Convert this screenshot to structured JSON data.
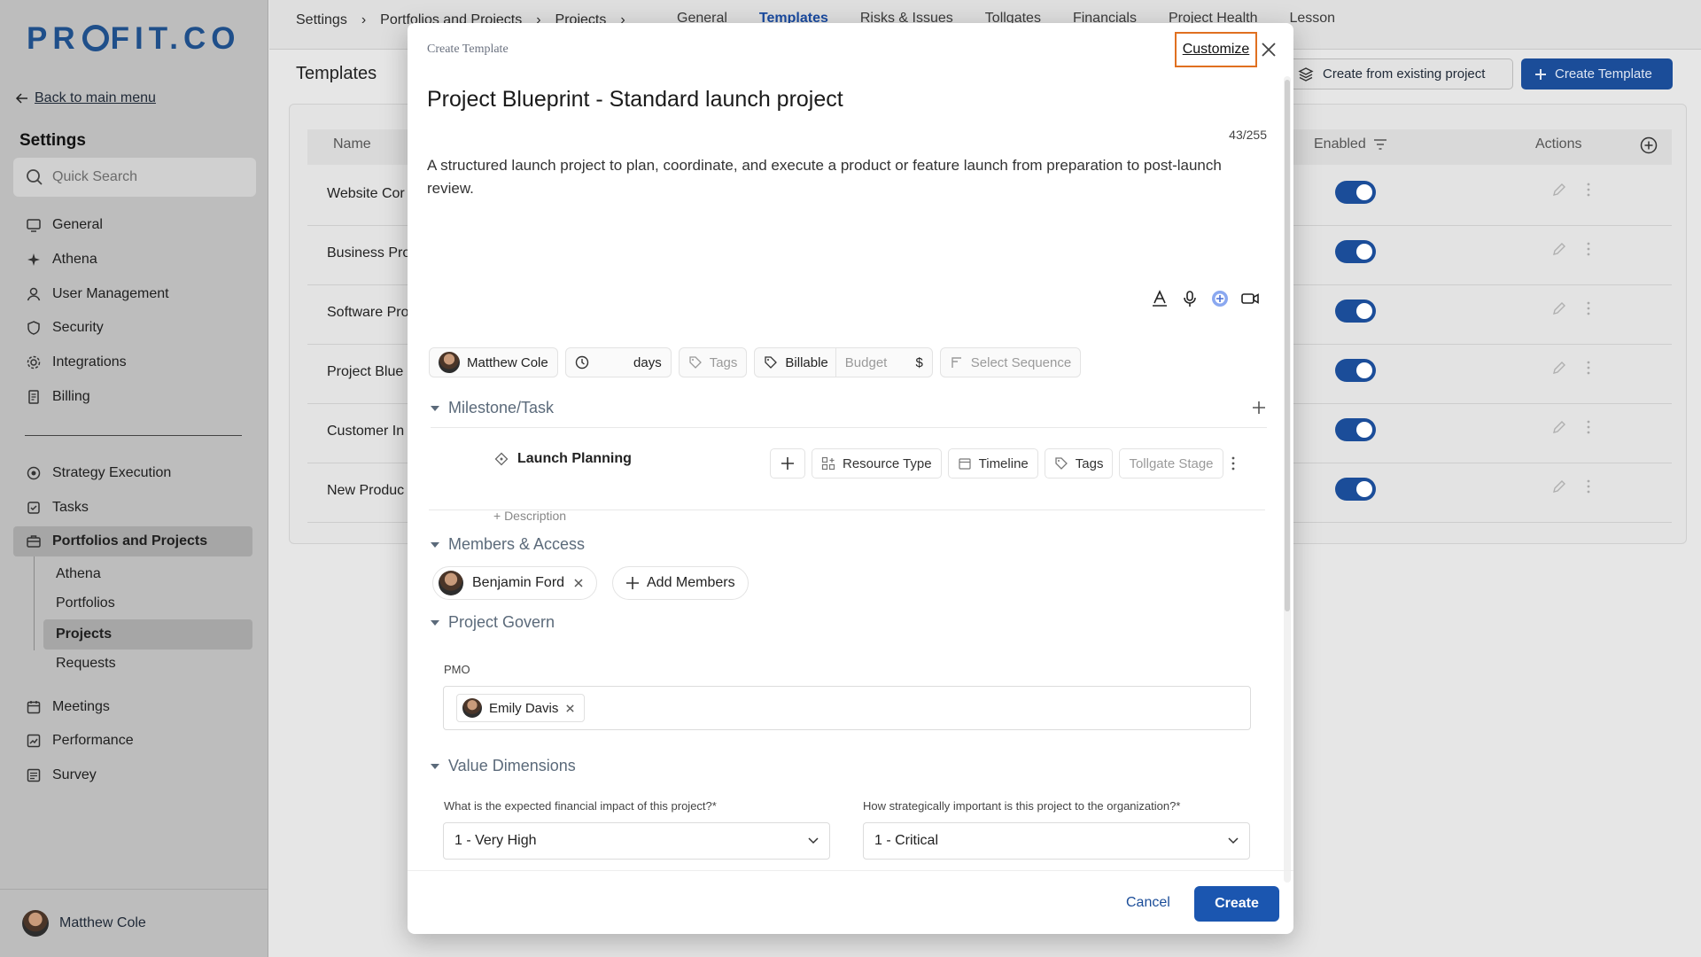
{
  "brand": {
    "logo_text_a": "PR",
    "logo_text_b": "FIT.CO"
  },
  "sidebar": {
    "back_label": "Back to main menu",
    "title": "Settings",
    "search_placeholder": "Quick Search",
    "items": [
      {
        "label": "General",
        "icon": "monitor-icon"
      },
      {
        "label": "Athena",
        "icon": "sparkle-icon"
      },
      {
        "label": "User Management",
        "icon": "user-icon"
      },
      {
        "label": "Security",
        "icon": "shield-icon"
      },
      {
        "label": "Integrations",
        "icon": "gear-icon"
      },
      {
        "label": "Billing",
        "icon": "receipt-icon"
      }
    ],
    "items2": [
      {
        "label": "Strategy Execution",
        "icon": "target-icon"
      },
      {
        "label": "Tasks",
        "icon": "checkbox-icon"
      },
      {
        "label": "Portfolios and Projects",
        "icon": "briefcase-icon"
      }
    ],
    "subitems": [
      "Athena",
      "Portfolios",
      "Projects",
      "Requests"
    ],
    "items3": [
      {
        "label": "Meetings",
        "icon": "calendar-icon"
      },
      {
        "label": "Performance",
        "icon": "chart-icon"
      },
      {
        "label": "Survey",
        "icon": "survey-icon"
      }
    ],
    "user": "Matthew Cole"
  },
  "header": {
    "breadcrumbs": [
      "Settings",
      "Portfolios and Projects",
      "Projects"
    ],
    "tabs": [
      "General",
      "Templates",
      "Risks & Issues",
      "Tollgates",
      "Financials",
      "Project Health",
      "Lesson"
    ],
    "active_tab": "Templates"
  },
  "page": {
    "title": "Templates",
    "create_existing": "Create from existing project",
    "create_template": "Create Template"
  },
  "table": {
    "headers": {
      "name": "Name",
      "enabled": "Enabled",
      "actions": "Actions"
    },
    "rows": [
      "Website Cor",
      "Business Pro",
      "Software Pro",
      "Project Blue",
      "Customer In",
      "New Produc"
    ]
  },
  "modal": {
    "header": "Create Template",
    "customize": "Customize",
    "title": "Project Blueprint - Standard launch project",
    "char_count": "43/255",
    "description": "A structured launch project to plan, coordinate, and execute a product or feature launch from preparation to post-launch review.",
    "chips": {
      "owner": "Matthew Cole",
      "days": "days",
      "tags": "Tags",
      "billable": "Billable",
      "budget": "Budget",
      "currency": "$",
      "sequence": "Select Sequence"
    },
    "milestone": {
      "section": "Milestone/Task",
      "task": "Launch Planning",
      "add_description": "+ Description",
      "resource_type": "Resource Type",
      "timeline": "Timeline",
      "tags": "Tags",
      "tollgate": "Tollgate Stage"
    },
    "members": {
      "section": "Members & Access",
      "member": "Benjamin Ford",
      "add": "Add Members"
    },
    "govern": {
      "section": "Project Govern",
      "pmo_label": "PMO",
      "pmo_member": "Emily Davis"
    },
    "value": {
      "section": "Value Dimensions",
      "q1": "What is the expected financial impact of this project?*",
      "a1": "1 - Very High",
      "q2": "How strategically important is this project to the organization?*",
      "a2": "1 - Critical"
    },
    "cancel": "Cancel",
    "create": "Create"
  }
}
